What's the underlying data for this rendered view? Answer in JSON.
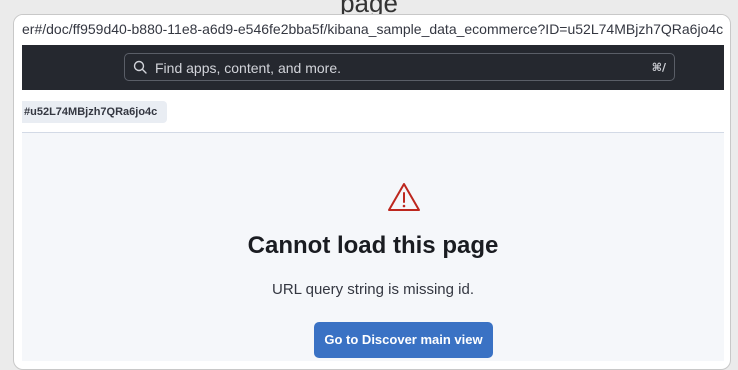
{
  "browser": {
    "url": "er#/doc/ff959d40-b880-11e8-a6d9-e546fe2bba5f/kibana_sample_data_ecommerce?ID=u52L74MBjzh7QRa6jo4c"
  },
  "header": {
    "search": {
      "placeholder": "Find apps, content, and more.",
      "shortcut": "⌘/",
      "icon": "search-icon"
    }
  },
  "breadcrumb": {
    "current": "#u52L74MBjzh7QRa6jo4c"
  },
  "error": {
    "icon": "warning-icon",
    "title": "Cannot load this page",
    "description": "URL query string is missing id.",
    "button_label": "Go to Discover main view"
  },
  "colors": {
    "header_bg": "#25282f",
    "primary": "#3a72c4",
    "warning": "#bd271e",
    "content_bg": "#f5f7fa"
  }
}
